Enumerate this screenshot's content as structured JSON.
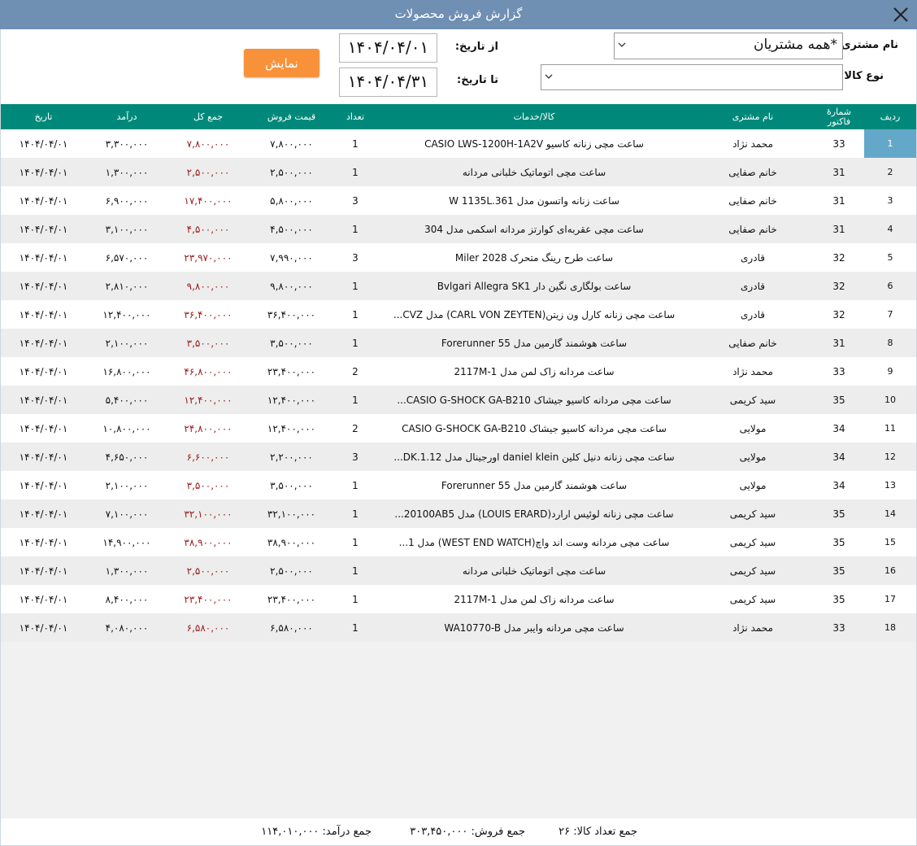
{
  "window": {
    "title": "گزارش فروش محصولات",
    "close_icon": "close-icon"
  },
  "filters": {
    "customer_label": "نام مشتری:",
    "customer_value": "*همه مشتریان",
    "product_type_label": "نوع کالا:",
    "product_type_value": "",
    "from_date_label": "از تاریخ:",
    "from_date_value": "۱۴۰۴/۰۴/۰۱",
    "to_date_label": "تا تاریخ:",
    "to_date_value": "۱۴۰۴/۰۴/۳۱",
    "show_button": "نمایش"
  },
  "columns": {
    "radif": "ردیف",
    "invoice_no": "شمارهٔ\nفاکتور",
    "customer": "نام مشتری",
    "item": "کالا/خدمات",
    "qty": "تعداد",
    "price": "قیمت فروش",
    "total": "جمع کل",
    "income": "درآمد",
    "date": "تاریخ"
  },
  "rows": [
    {
      "radif": "1",
      "invoice": "33",
      "customer": "محمد نژاد",
      "item": "ساعت مچی زنانه کاسیو CASIO LWS-1200H-1A2V",
      "qty": "1",
      "price": "۷,۸۰۰,۰۰۰",
      "total": "۷,۸۰۰,۰۰۰",
      "income": "۳,۳۰۰,۰۰۰",
      "date": "۱۴۰۴/۰۴/۰۱"
    },
    {
      "radif": "2",
      "invoice": "31",
      "customer": "خانم صفایی",
      "item": "ساعت مچی اتوماتیک خلبانی مردانه",
      "qty": "1",
      "price": "۲,۵۰۰,۰۰۰",
      "total": "۲,۵۰۰,۰۰۰",
      "income": "۱,۳۰۰,۰۰۰",
      "date": "۱۴۰۴/۰۴/۰۱"
    },
    {
      "radif": "3",
      "invoice": "31",
      "customer": "خانم صفایی",
      "item": "ساعت زنانه واتسون مدل W 1135L.361",
      "qty": "3",
      "price": "۵,۸۰۰,۰۰۰",
      "total": "۱۷,۴۰۰,۰۰۰",
      "income": "۶,۹۰۰,۰۰۰",
      "date": "۱۴۰۴/۰۴/۰۱"
    },
    {
      "radif": "4",
      "invoice": "31",
      "customer": "خانم صفایی",
      "item": "ساعت مچی عقربه‌ای کوارتز مردانه اسکمی مدل 304",
      "qty": "1",
      "price": "۴,۵۰۰,۰۰۰",
      "total": "۴,۵۰۰,۰۰۰",
      "income": "۳,۱۰۰,۰۰۰",
      "date": "۱۴۰۴/۰۴/۰۱"
    },
    {
      "radif": "5",
      "invoice": "32",
      "customer": "قادری",
      "item": "ساعت طرح رینگ متحرک Miler 2028",
      "qty": "3",
      "price": "۷,۹۹۰,۰۰۰",
      "total": "۲۳,۹۷۰,۰۰۰",
      "income": "۶,۵۷۰,۰۰۰",
      "date": "۱۴۰۴/۰۴/۰۱"
    },
    {
      "radif": "6",
      "invoice": "32",
      "customer": "قادری",
      "item": "ساعت بولگاری نگین دار Bvlgari Allegra SK1",
      "qty": "1",
      "price": "۹,۸۰۰,۰۰۰",
      "total": "۹,۸۰۰,۰۰۰",
      "income": "۲,۸۱۰,۰۰۰",
      "date": "۱۴۰۴/۰۴/۰۱"
    },
    {
      "radif": "7",
      "invoice": "32",
      "customer": "قادری",
      "item": "ساعت مچی زنانه کارل ون زیتن(CARL VON ZEYTEN) مدل CVZ...",
      "qty": "1",
      "price": "۳۶,۴۰۰,۰۰۰",
      "total": "۳۶,۴۰۰,۰۰۰",
      "income": "۱۲,۴۰۰,۰۰۰",
      "date": "۱۴۰۴/۰۴/۰۱"
    },
    {
      "radif": "8",
      "invoice": "31",
      "customer": "خانم صفایی",
      "item": "ساعت هوشمند گارمین مدل Forerunner 55",
      "qty": "1",
      "price": "۳,۵۰۰,۰۰۰",
      "total": "۳,۵۰۰,۰۰۰",
      "income": "۲,۱۰۰,۰۰۰",
      "date": "۱۴۰۴/۰۴/۰۱"
    },
    {
      "radif": "9",
      "invoice": "33",
      "customer": "محمد نژاد",
      "item": "ساعت مردانه زاک لمن مدل 2117M-1",
      "qty": "2",
      "price": "۲۳,۴۰۰,۰۰۰",
      "total": "۴۶,۸۰۰,۰۰۰",
      "income": "۱۶,۸۰۰,۰۰۰",
      "date": "۱۴۰۴/۰۴/۰۱"
    },
    {
      "radif": "10",
      "invoice": "35",
      "customer": "سید کریمی",
      "item": "ساعت مچی مردانه کاسیو جیشاک CASIO G-SHOCK GA-B210...",
      "qty": "1",
      "price": "۱۲,۴۰۰,۰۰۰",
      "total": "۱۲,۴۰۰,۰۰۰",
      "income": "۵,۴۰۰,۰۰۰",
      "date": "۱۴۰۴/۰۴/۰۱"
    },
    {
      "radif": "11",
      "invoice": "34",
      "customer": "مولایی",
      "item": "ساعت مچی مردانه کاسیو جیشاک CASIO G-SHOCK GA-B210",
      "qty": "2",
      "price": "۱۲,۴۰۰,۰۰۰",
      "total": "۲۴,۸۰۰,۰۰۰",
      "income": "۱۰,۸۰۰,۰۰۰",
      "date": "۱۴۰۴/۰۴/۰۱"
    },
    {
      "radif": "12",
      "invoice": "34",
      "customer": "مولایی",
      "item": "ساعت مچی زنانه دنیل کلین daniel klein اورجینال مدل DK.1.12...",
      "qty": "3",
      "price": "۲,۲۰۰,۰۰۰",
      "total": "۶,۶۰۰,۰۰۰",
      "income": "۴,۶۵۰,۰۰۰",
      "date": "۱۴۰۴/۰۴/۰۱"
    },
    {
      "radif": "13",
      "invoice": "34",
      "customer": "مولایی",
      "item": "ساعت هوشمند گارمین مدل Forerunner 55",
      "qty": "1",
      "price": "۳,۵۰۰,۰۰۰",
      "total": "۳,۵۰۰,۰۰۰",
      "income": "۲,۱۰۰,۰۰۰",
      "date": "۱۴۰۴/۰۴/۰۱"
    },
    {
      "radif": "14",
      "invoice": "35",
      "customer": "سید کریمی",
      "item": "ساعت مچی زنانه لوئیس ارارد(LOUIS ERARD) مدل 20100AB5...",
      "qty": "1",
      "price": "۳۲,۱۰۰,۰۰۰",
      "total": "۳۲,۱۰۰,۰۰۰",
      "income": "۷,۱۰۰,۰۰۰",
      "date": "۱۴۰۴/۰۴/۰۱"
    },
    {
      "radif": "15",
      "invoice": "35",
      "customer": "سید کریمی",
      "item": "ساعت مچی مردانه وست اند واچ(WEST END WATCH) مدل 1...",
      "qty": "1",
      "price": "۳۸,۹۰۰,۰۰۰",
      "total": "۳۸,۹۰۰,۰۰۰",
      "income": "۱۴,۹۰۰,۰۰۰",
      "date": "۱۴۰۴/۰۴/۰۱"
    },
    {
      "radif": "16",
      "invoice": "35",
      "customer": "سید کریمی",
      "item": "ساعت مچی اتوماتیک خلبانی مردانه",
      "qty": "1",
      "price": "۲,۵۰۰,۰۰۰",
      "total": "۲,۵۰۰,۰۰۰",
      "income": "۱,۳۰۰,۰۰۰",
      "date": "۱۴۰۴/۰۴/۰۱"
    },
    {
      "radif": "17",
      "invoice": "35",
      "customer": "سید کریمی",
      "item": "ساعت مردانه زاک لمن مدل 2117M-1",
      "qty": "1",
      "price": "۲۳,۴۰۰,۰۰۰",
      "total": "۲۳,۴۰۰,۰۰۰",
      "income": "۸,۴۰۰,۰۰۰",
      "date": "۱۴۰۴/۰۴/۰۱"
    },
    {
      "radif": "18",
      "invoice": "33",
      "customer": "محمد نژاد",
      "item": "ساعت مچی مردانه وایبر مدل WA10770-B",
      "qty": "1",
      "price": "۶,۵۸۰,۰۰۰",
      "total": "۶,۵۸۰,۰۰۰",
      "income": "۴,۰۸۰,۰۰۰",
      "date": "۱۴۰۴/۰۴/۰۱"
    }
  ],
  "footer": {
    "qty_total": "جمع تعداد کالا: ۲۶",
    "sales_total": "جمع فروش: ۳۰۳,۴۵۰,۰۰۰",
    "income_total": "جمع درآمد: ۱۱۴,۰۱۰,۰۰۰"
  },
  "colors": {
    "titlebar": "#6f8fb3",
    "header": "#00897b",
    "button": "#f7923b",
    "total_text": "#9a1a1a",
    "selected": "#64a8c9"
  }
}
